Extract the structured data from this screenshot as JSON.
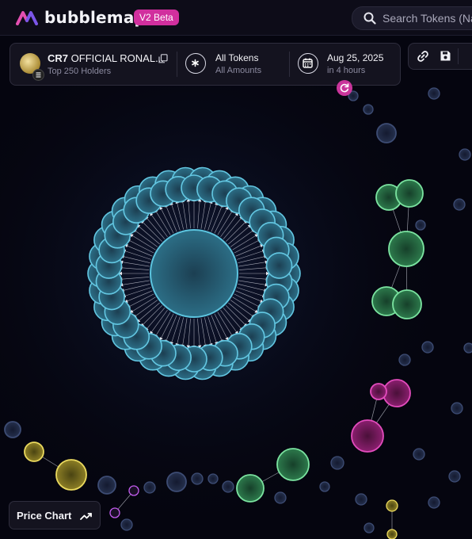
{
  "header": {
    "brand": "bubblemaps",
    "badge": "V2 Beta",
    "search_placeholder": "Search Tokens (Na"
  },
  "token": {
    "symbol": "CR7",
    "name": "OFFICIAL RONAL...",
    "subtitle": "Top 250 Holders"
  },
  "filters": {
    "tokens_title": "All Tokens",
    "tokens_sub": "All Amounts"
  },
  "date": {
    "title": "Aug 25, 2025",
    "sub": "in 4 hours"
  },
  "footer": {
    "price_chart_label": "Price Chart"
  },
  "colors": {
    "accent": "#d12f9e",
    "cluster_blue": "#4bb4cf",
    "cluster_green": "#6fd28e",
    "cluster_pink": "#d63ab1",
    "cluster_yellow": "#e3d35a",
    "cluster_purple": "#b54ee0"
  },
  "icons": [
    "logo-icon",
    "search-icon",
    "copy-icon",
    "asterisk-icon",
    "calendar-icon",
    "link-icon",
    "save-icon",
    "refresh-icon",
    "trend-icon"
  ]
}
